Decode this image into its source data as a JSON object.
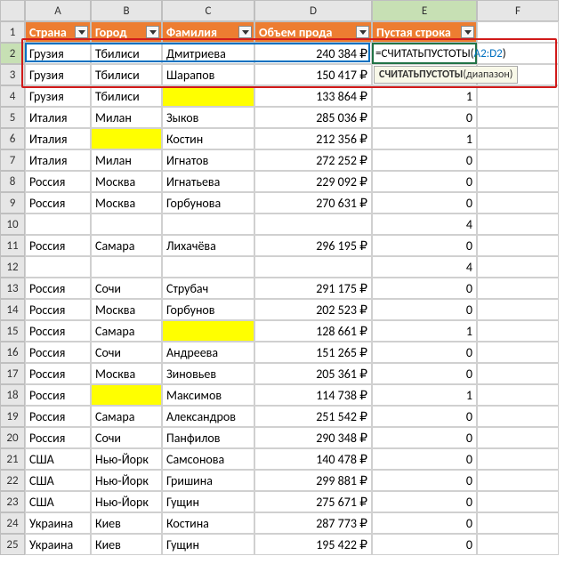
{
  "columns": [
    "",
    "A",
    "B",
    "C",
    "D",
    "E",
    "F"
  ],
  "column_headers": {
    "A": "Страна",
    "B": "Город",
    "C": "Фамилия",
    "D": "Объем прода",
    "E": "Пустая строка"
  },
  "rows": [
    {
      "n": 2,
      "A": "Грузия",
      "B": "Тбилиси",
      "C": "Дмитриева",
      "D": "240 384 ₽",
      "E_formula": "=СЧИТАТЬПУСТОТЫ(",
      "E_ref": "A2:D2",
      "E_close": ")"
    },
    {
      "n": 3,
      "A": "Грузия",
      "B": "Тбилиси",
      "C": "Шарапов",
      "D": "150 417 ₽",
      "E": ""
    },
    {
      "n": 4,
      "A": "Грузия",
      "B": "Тбилиси",
      "C": "",
      "C_yellow": true,
      "D": "133 864 ₽",
      "E": "1"
    },
    {
      "n": 5,
      "A": "Италия",
      "B": "Милан",
      "C": "Зыков",
      "D": "285 036 ₽",
      "E": "0"
    },
    {
      "n": 6,
      "A": "Италия",
      "B": "",
      "B_yellow": true,
      "C": "Костин",
      "D": "212 356 ₽",
      "E": "1"
    },
    {
      "n": 7,
      "A": "Италия",
      "B": "Милан",
      "C": "Игнатов",
      "D": "272 252 ₽",
      "E": "0"
    },
    {
      "n": 8,
      "A": "Россия",
      "B": "Москва",
      "C": "Игнатьева",
      "D": "229 092 ₽",
      "E": "0"
    },
    {
      "n": 9,
      "A": "Россия",
      "B": "Москва",
      "C": "Горбунова",
      "D": "270 631 ₽",
      "E": "0"
    },
    {
      "n": 10,
      "A": "",
      "B": "",
      "C": "",
      "D": "",
      "E": "4"
    },
    {
      "n": 11,
      "A": "Россия",
      "B": "Самара",
      "C": "Лихачёва",
      "D": "296 195 ₽",
      "E": "0"
    },
    {
      "n": 12,
      "A": "",
      "B": "",
      "C": "",
      "D": "",
      "E": "4"
    },
    {
      "n": 13,
      "A": "Россия",
      "B": "Сочи",
      "C": "Струбач",
      "D": "291 175 ₽",
      "E": "0"
    },
    {
      "n": 14,
      "A": "Россия",
      "B": "Москва",
      "C": "Горбунов",
      "D": "202 523 ₽",
      "E": "0"
    },
    {
      "n": 15,
      "A": "Россия",
      "B": "Самара",
      "C": "",
      "C_yellow": true,
      "D": "128 661 ₽",
      "E": "1"
    },
    {
      "n": 16,
      "A": "Россия",
      "B": "Сочи",
      "C": "Андреева",
      "D": "151 265 ₽",
      "E": "0"
    },
    {
      "n": 17,
      "A": "Россия",
      "B": "Москва",
      "C": "Зиновьев",
      "D": "205 361 ₽",
      "E": "0"
    },
    {
      "n": 18,
      "A": "Россия",
      "B": "",
      "B_yellow": true,
      "C": "Максимов",
      "D": "114 738 ₽",
      "E": "1"
    },
    {
      "n": 19,
      "A": "Россия",
      "B": "Самара",
      "C": "Александров",
      "D": "251 542 ₽",
      "E": "0"
    },
    {
      "n": 20,
      "A": "Россия",
      "B": "Сочи",
      "C": "Панфилов",
      "D": "290 348 ₽",
      "E": "0"
    },
    {
      "n": 21,
      "A": "США",
      "B": "Нью-Йорк",
      "C": "Самсонова",
      "D": "140 478 ₽",
      "E": "0"
    },
    {
      "n": 22,
      "A": "США",
      "B": "Нью-Йорк",
      "C": "Гришина",
      "D": "299 881 ₽",
      "E": "0"
    },
    {
      "n": 23,
      "A": "США",
      "B": "Нью-Йорк",
      "C": "Гущин",
      "D": "275 671 ₽",
      "E": "0"
    },
    {
      "n": 24,
      "A": "Украина",
      "B": "Киев",
      "C": "Костина",
      "D": "287 773 ₽",
      "E": "0"
    },
    {
      "n": 25,
      "A": "Украина",
      "B": "Киев",
      "C": "Гущин",
      "D": "195 422 ₽",
      "E": "0"
    }
  ],
  "tooltip": {
    "fn": "СЧИТАТЬПУСТОТЫ",
    "args": "(диапазон)"
  },
  "active_cell": "E2"
}
